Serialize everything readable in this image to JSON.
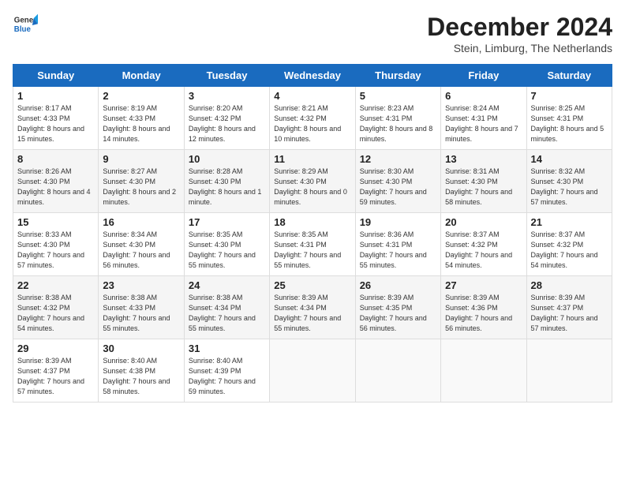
{
  "header": {
    "logo_line1": "General",
    "logo_line2": "Blue",
    "month_title": "December 2024",
    "location": "Stein, Limburg, The Netherlands"
  },
  "days_of_week": [
    "Sunday",
    "Monday",
    "Tuesday",
    "Wednesday",
    "Thursday",
    "Friday",
    "Saturday"
  ],
  "weeks": [
    [
      {
        "day": "1",
        "sunrise": "8:17 AM",
        "sunset": "4:33 PM",
        "daylight": "8 hours and 15 minutes."
      },
      {
        "day": "2",
        "sunrise": "8:19 AM",
        "sunset": "4:33 PM",
        "daylight": "8 hours and 14 minutes."
      },
      {
        "day": "3",
        "sunrise": "8:20 AM",
        "sunset": "4:32 PM",
        "daylight": "8 hours and 12 minutes."
      },
      {
        "day": "4",
        "sunrise": "8:21 AM",
        "sunset": "4:32 PM",
        "daylight": "8 hours and 10 minutes."
      },
      {
        "day": "5",
        "sunrise": "8:23 AM",
        "sunset": "4:31 PM",
        "daylight": "8 hours and 8 minutes."
      },
      {
        "day": "6",
        "sunrise": "8:24 AM",
        "sunset": "4:31 PM",
        "daylight": "8 hours and 7 minutes."
      },
      {
        "day": "7",
        "sunrise": "8:25 AM",
        "sunset": "4:31 PM",
        "daylight": "8 hours and 5 minutes."
      }
    ],
    [
      {
        "day": "8",
        "sunrise": "8:26 AM",
        "sunset": "4:30 PM",
        "daylight": "8 hours and 4 minutes."
      },
      {
        "day": "9",
        "sunrise": "8:27 AM",
        "sunset": "4:30 PM",
        "daylight": "8 hours and 2 minutes."
      },
      {
        "day": "10",
        "sunrise": "8:28 AM",
        "sunset": "4:30 PM",
        "daylight": "8 hours and 1 minute."
      },
      {
        "day": "11",
        "sunrise": "8:29 AM",
        "sunset": "4:30 PM",
        "daylight": "8 hours and 0 minutes."
      },
      {
        "day": "12",
        "sunrise": "8:30 AM",
        "sunset": "4:30 PM",
        "daylight": "7 hours and 59 minutes."
      },
      {
        "day": "13",
        "sunrise": "8:31 AM",
        "sunset": "4:30 PM",
        "daylight": "7 hours and 58 minutes."
      },
      {
        "day": "14",
        "sunrise": "8:32 AM",
        "sunset": "4:30 PM",
        "daylight": "7 hours and 57 minutes."
      }
    ],
    [
      {
        "day": "15",
        "sunrise": "8:33 AM",
        "sunset": "4:30 PM",
        "daylight": "7 hours and 57 minutes."
      },
      {
        "day": "16",
        "sunrise": "8:34 AM",
        "sunset": "4:30 PM",
        "daylight": "7 hours and 56 minutes."
      },
      {
        "day": "17",
        "sunrise": "8:35 AM",
        "sunset": "4:30 PM",
        "daylight": "7 hours and 55 minutes."
      },
      {
        "day": "18",
        "sunrise": "8:35 AM",
        "sunset": "4:31 PM",
        "daylight": "7 hours and 55 minutes."
      },
      {
        "day": "19",
        "sunrise": "8:36 AM",
        "sunset": "4:31 PM",
        "daylight": "7 hours and 55 minutes."
      },
      {
        "day": "20",
        "sunrise": "8:37 AM",
        "sunset": "4:32 PM",
        "daylight": "7 hours and 54 minutes."
      },
      {
        "day": "21",
        "sunrise": "8:37 AM",
        "sunset": "4:32 PM",
        "daylight": "7 hours and 54 minutes."
      }
    ],
    [
      {
        "day": "22",
        "sunrise": "8:38 AM",
        "sunset": "4:32 PM",
        "daylight": "7 hours and 54 minutes."
      },
      {
        "day": "23",
        "sunrise": "8:38 AM",
        "sunset": "4:33 PM",
        "daylight": "7 hours and 55 minutes."
      },
      {
        "day": "24",
        "sunrise": "8:38 AM",
        "sunset": "4:34 PM",
        "daylight": "7 hours and 55 minutes."
      },
      {
        "day": "25",
        "sunrise": "8:39 AM",
        "sunset": "4:34 PM",
        "daylight": "7 hours and 55 minutes."
      },
      {
        "day": "26",
        "sunrise": "8:39 AM",
        "sunset": "4:35 PM",
        "daylight": "7 hours and 56 minutes."
      },
      {
        "day": "27",
        "sunrise": "8:39 AM",
        "sunset": "4:36 PM",
        "daylight": "7 hours and 56 minutes."
      },
      {
        "day": "28",
        "sunrise": "8:39 AM",
        "sunset": "4:37 PM",
        "daylight": "7 hours and 57 minutes."
      }
    ],
    [
      {
        "day": "29",
        "sunrise": "8:39 AM",
        "sunset": "4:37 PM",
        "daylight": "7 hours and 57 minutes."
      },
      {
        "day": "30",
        "sunrise": "8:40 AM",
        "sunset": "4:38 PM",
        "daylight": "7 hours and 58 minutes."
      },
      {
        "day": "31",
        "sunrise": "8:40 AM",
        "sunset": "4:39 PM",
        "daylight": "7 hours and 59 minutes."
      },
      null,
      null,
      null,
      null
    ]
  ]
}
